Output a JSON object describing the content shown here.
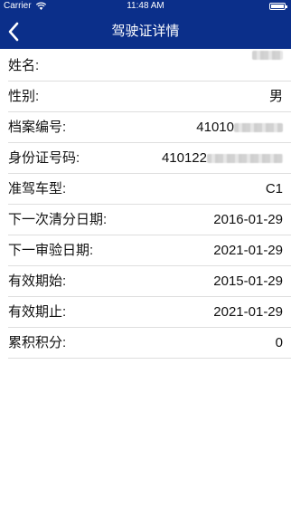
{
  "status_bar": {
    "carrier": "Carrier",
    "time": "11:48 AM"
  },
  "nav": {
    "title": "驾驶证详情"
  },
  "rows": [
    {
      "label": "姓名:",
      "value": ""
    },
    {
      "label": "性别:",
      "value": "男"
    },
    {
      "label": "档案编号:",
      "value": "41010"
    },
    {
      "label": "身份证号码:",
      "value": "410122"
    },
    {
      "label": "准驾车型:",
      "value": "C1"
    },
    {
      "label": "下一次清分日期:",
      "value": "2016-01-29"
    },
    {
      "label": "下一审验日期:",
      "value": "2021-01-29"
    },
    {
      "label": "有效期始:",
      "value": "2015-01-29"
    },
    {
      "label": "有效期止:",
      "value": "2021-01-29"
    },
    {
      "label": "累积积分:",
      "value": "0"
    }
  ],
  "colors": {
    "header_bg": "#0b2f8a",
    "divider": "#dedede"
  }
}
